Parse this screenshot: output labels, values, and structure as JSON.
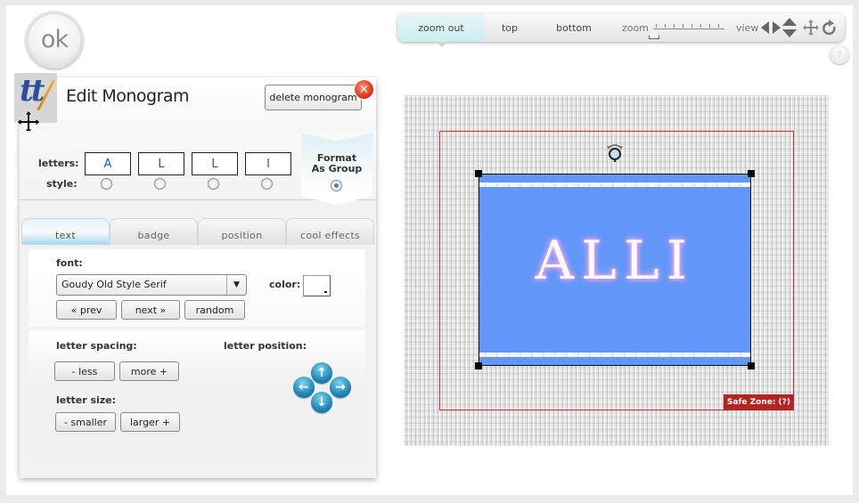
{
  "ok_button": {
    "label": "ok"
  },
  "editor": {
    "title": "Edit Monogram",
    "delete_label": "delete monogram",
    "close_icon": "close-icon",
    "letters_label": "letters:",
    "style_label": "style:",
    "letters": [
      "A",
      "L",
      "L",
      "I"
    ],
    "format_group_label_line1": "Format",
    "format_group_label_line2": "As Group",
    "format_group_selected": true,
    "tabs": [
      {
        "label": "text",
        "active": true
      },
      {
        "label": "badge",
        "active": false
      },
      {
        "label": "position",
        "active": false
      },
      {
        "label": "cool effects",
        "active": false
      }
    ],
    "font_label": "font:",
    "font_value": "Goudy Old Style Serif",
    "color_label": "color:",
    "color_value": "#ffffff",
    "prev_label": "« prev",
    "next_label": "next »",
    "random_label": "random",
    "letter_spacing_label": "letter spacing:",
    "less_label": "- less",
    "more_label": "more +",
    "letter_size_label": "letter size:",
    "smaller_label": "- smaller",
    "larger_label": "larger +",
    "letter_position_label": "letter position:",
    "arrow_up": "↑",
    "arrow_down": "↓",
    "arrow_left": "←",
    "arrow_right": "→"
  },
  "toolbar": {
    "zoom_out_label": "zoom out",
    "top_label": "top",
    "bottom_label": "bottom",
    "zoom_label": "zoom",
    "zoom_level_fraction": 0.0,
    "view_label": "view",
    "help_label": "?"
  },
  "canvas": {
    "monogram_text": "ALLI",
    "background_color": "#6296f8",
    "text_glow_color": "#ffb6ee",
    "safe_zone_label": "Safe Zone: (?)",
    "safe_zone_color": "#b42424"
  }
}
